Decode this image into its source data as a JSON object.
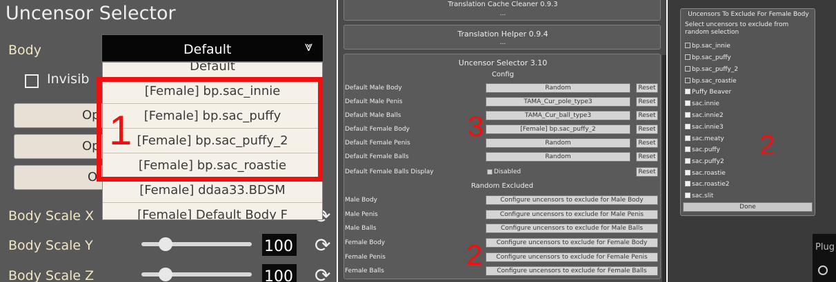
{
  "left_panel": {
    "title": "Uncensor Selector",
    "body_label": "Body",
    "dropdown_value": "Default",
    "dropdown_items": [
      "Default",
      "[Female] bp.sac_innie",
      "[Female] bp.sac_puffy",
      "[Female] bp.sac_puffy_2",
      "[Female] bp.sac_roastie",
      "[Female] ddaa33.BDSM",
      "[Female] Default Body F"
    ],
    "invisible_label": "Invisib",
    "buttons": [
      "Op",
      "Op",
      "O"
    ],
    "scales": [
      {
        "label": "Body Scale X",
        "value": "100",
        "slider_level": 0.2
      },
      {
        "label": "Body Scale Y",
        "value": "100",
        "slider_level": 0.2
      },
      {
        "label": "Body Scale Z",
        "value": "100",
        "slider_level": 0.2
      }
    ],
    "annotation": "1"
  },
  "middle_panel": {
    "cache_cleaner": {
      "title": "Translation Cache Cleaner 0.9.3",
      "sub": "..."
    },
    "translation_helper": {
      "title": "Translation Helper 0.9.4",
      "sub": "..."
    },
    "uncensor_selector": {
      "title": "Uncensor Selector 3.10",
      "config_header": "Config",
      "reset_label": "Reset",
      "rows": [
        {
          "label": "Default Male Body",
          "value": "Random"
        },
        {
          "label": "Default Male Penis",
          "value": "TAMA_Cur_pole_type3"
        },
        {
          "label": "Default Male Balls",
          "value": "TAMA_Cur_ball_type3"
        },
        {
          "label": "Default Female Body",
          "value": "[Female] bp.sac_puffy_2"
        },
        {
          "label": "Default Female Penis",
          "value": "Random"
        },
        {
          "label": "Default Female Balls",
          "value": "Random"
        }
      ],
      "balls_display": {
        "label": "Default Female Balls Display",
        "value": "Disabled"
      },
      "random_header": "Random Excluded",
      "excluded": [
        {
          "label": "Male Body",
          "button": "Configure uncensors to exclude for Male Body"
        },
        {
          "label": "Male Penis",
          "button": "Configure uncensors to exclude for Male Penis"
        },
        {
          "label": "Male Balls",
          "button": "Configure uncensors to exclude for Male Balls"
        },
        {
          "label": "Female Body",
          "button": "Configure uncensors to exclude for Female Body"
        },
        {
          "label": "Female Penis",
          "button": "Configure uncensors to exclude for Female Penis"
        },
        {
          "label": "Female Balls",
          "button": "Configure uncensors to exclude for Female Balls"
        }
      ]
    },
    "annotation_3": "3",
    "annotation_2": "2"
  },
  "right_panel": {
    "title": "Uncensors To Exclude For Female Body",
    "description": "Select uncensors to exclude from random selection",
    "items": [
      {
        "label": "bp.sac_innie",
        "checked": false
      },
      {
        "label": "bp.sac_puffy",
        "checked": false
      },
      {
        "label": "bp.sac_puffy_2",
        "checked": false
      },
      {
        "label": "bp.sac_roastie",
        "checked": false
      },
      {
        "label": "Puffy Beaver",
        "checked": true
      },
      {
        "label": "sac.innie",
        "checked": true
      },
      {
        "label": "sac.innie2",
        "checked": true
      },
      {
        "label": "sac.innie3",
        "checked": true
      },
      {
        "label": "sac.meaty",
        "checked": true
      },
      {
        "label": "sac.puffy",
        "checked": true
      },
      {
        "label": "sac.puffy2",
        "checked": true
      },
      {
        "label": "sac.roastie",
        "checked": true
      },
      {
        "label": "sac.roastie2",
        "checked": true
      },
      {
        "label": "sac.slit",
        "checked": true
      }
    ],
    "done_label": "Done",
    "annotation": "2",
    "plugin_fragment": "Plug"
  }
}
